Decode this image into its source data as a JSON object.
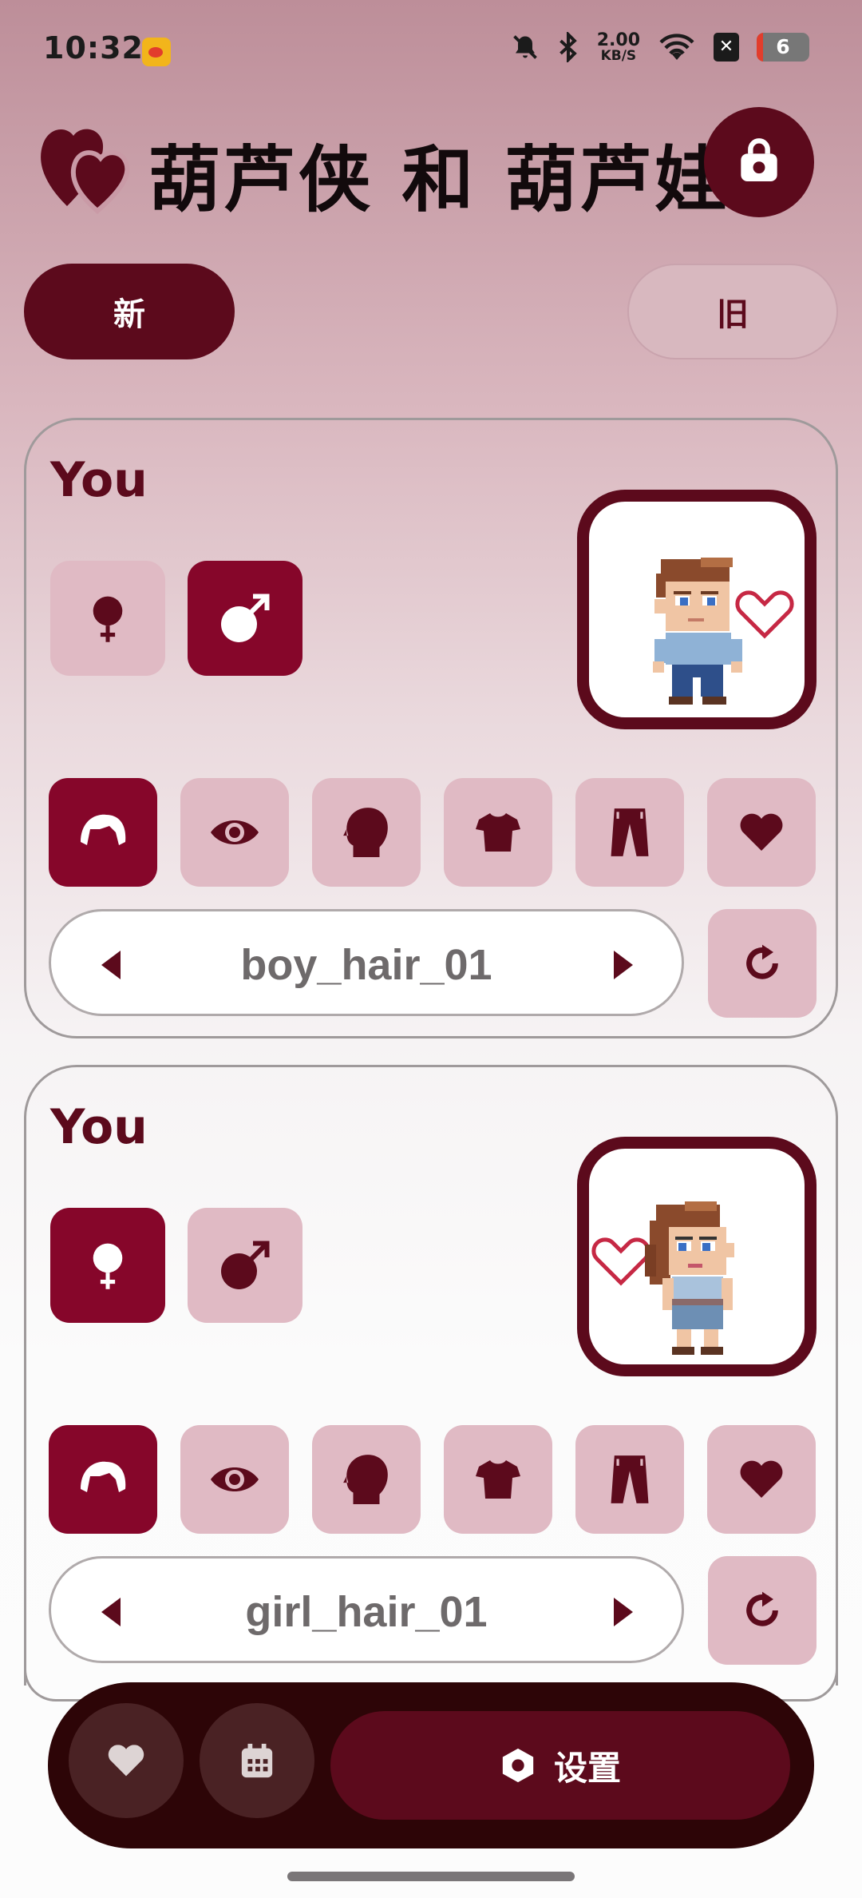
{
  "status_bar": {
    "time": "10:32",
    "net_speed_value": "2.00",
    "net_speed_unit": "KB/S",
    "battery": "6"
  },
  "header": {
    "title": "葫芦侠 和 葫芦娃"
  },
  "tabs": {
    "new_label": "新",
    "old_label": "旧"
  },
  "cards": [
    {
      "title": "You",
      "gender_selected": "male",
      "categories": [
        "hair",
        "eyes",
        "head",
        "shirt",
        "pants",
        "heart"
      ],
      "category_selected": "hair",
      "item_label": "boy_hair_01"
    },
    {
      "title": "You",
      "gender_selected": "female",
      "categories": [
        "hair",
        "eyes",
        "head",
        "shirt",
        "pants",
        "heart"
      ],
      "category_selected": "hair",
      "item_label": "girl_hair_01"
    }
  ],
  "bottom_nav": {
    "settings_label": "设置"
  },
  "colors": {
    "primary": "#5c0a1c",
    "selected": "#86062a",
    "unselected": "#e0bac4",
    "nav_bg": "#2d0507"
  }
}
